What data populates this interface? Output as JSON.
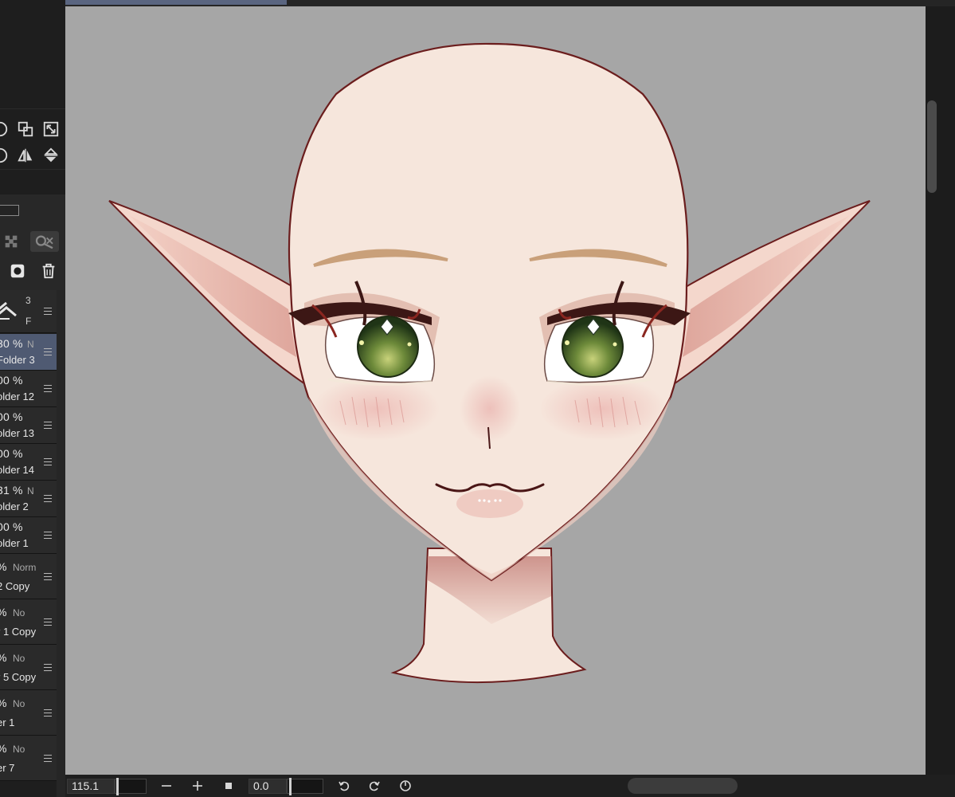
{
  "layers": [
    {
      "pct": "30 %",
      "mode": "N",
      "name": "Folder 3",
      "selected": true
    },
    {
      "pct": "00 %",
      "mode": "",
      "name": "older 12",
      "selected": false
    },
    {
      "pct": "00 %",
      "mode": "",
      "name": "older 13",
      "selected": false
    },
    {
      "pct": "00 %",
      "mode": "",
      "name": "older 14",
      "selected": false
    },
    {
      "pct": "31 %",
      "mode": "N",
      "name": "older 2",
      "selected": false
    },
    {
      "pct": "00 %",
      "mode": "",
      "name": "older 1",
      "selected": false
    },
    {
      "pct": "%",
      "mode": "Norm",
      "name": "2 Copy",
      "selected": false
    },
    {
      "pct": "%",
      "mode": "No",
      "name": "r 1 Copy",
      "selected": false
    },
    {
      "pct": "%",
      "mode": "No",
      "name": "r 5 Copy",
      "selected": false
    },
    {
      "pct": "%",
      "mode": "No",
      "name": "er 1",
      "selected": false
    },
    {
      "pct": "%",
      "mode": "No",
      "name": "er 7",
      "selected": false
    }
  ],
  "layer_header": {
    "count": "3",
    "mode": "F"
  },
  "bottombar": {
    "zoom": "115.1",
    "zoom_fill_fraction": 0.6,
    "rotation": "0.0",
    "rotation_fill_fraction": 0.05
  },
  "colors": {
    "canvas_bg": "#a6a6a6",
    "skin": "#f6e6dc",
    "outline": "#6b1d1d",
    "eye_green": "#4a6b2a",
    "selected_layer": "#4f5a72"
  }
}
